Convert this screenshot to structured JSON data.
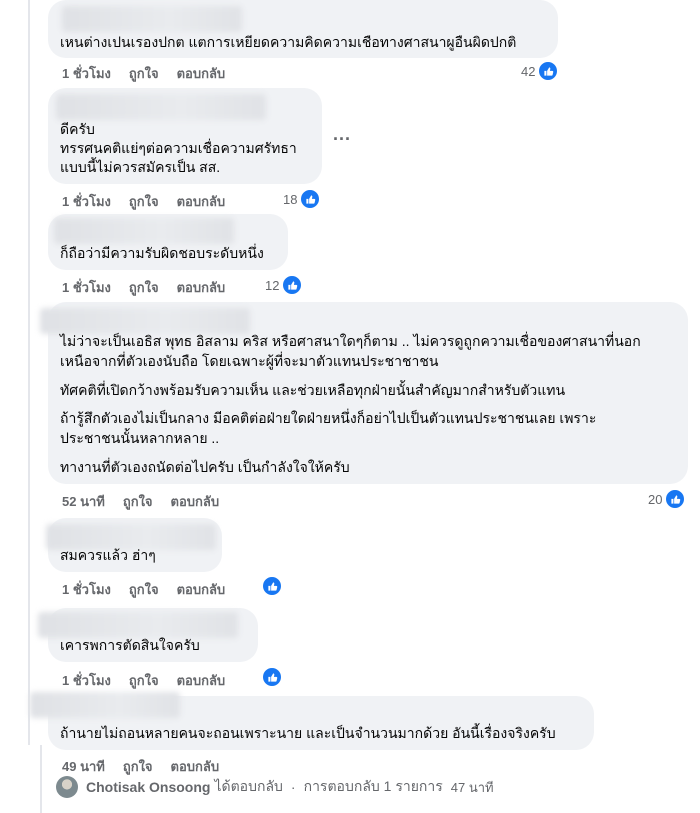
{
  "comments": [
    {
      "lines": [
        "เหนต่างเปนเรองปกต แตการเหยียดความคิดความเชือทางศาสนาผูอืนผิดปกติ"
      ],
      "time": "1 ชั่วโมง",
      "like": "ถูกใจ",
      "reply": "ตอบกลับ",
      "reactions": "42"
    },
    {
      "lines": [
        "ดีครับ",
        "ทรรศนคติแย่ๆต่อความเชื่อความศรัทธา",
        "แบบนี้ไม่ควรสมัครเป็น สส."
      ],
      "time": "1 ชั่วโมง",
      "like": "ถูกใจ",
      "reply": "ตอบกลับ",
      "reactions": "18",
      "more": "..."
    },
    {
      "lines": [
        "ก็ถือว่ามีความรับผิดชอบระดับหนึ่ง"
      ],
      "time": "1 ชั่วโมง",
      "like": "ถูกใจ",
      "reply": "ตอบกลับ",
      "reactions": "12"
    },
    {
      "lines": [
        "ไม่ว่าจะเป็นเอธิส พุทธ อิสลาม คริส หรือศาสนาใดๆก็ตาม .. ไม่ควรดูถูกความเชื่อของศาสนาที่นอก",
        "เหนือจากที่ตัวเองนับถือ โดยเฉพาะผู้ที่จะมาตัวแทนประชาชาชน",
        "ทัศคติที่เปิดกว้างพร้อมรับความเห็น และช่วยเหลือทุกฝ่ายนั้นสำคัญมากสำหรับตัวแทน",
        "ถ้ารู้สึกตัวเองไม่เป็นกลาง มีอคติต่อฝ่ายใดฝ่ายหนึ่งก็อย่าไปเป็นตัวแทนประชาชนเลย เพราะ",
        "ประชาชนนั้นหลากหลาย ..",
        "ทางานที่ตัวเองถนัดต่อไปครับ เป็นกำลังใจให้ครับ"
      ],
      "time": "52 นาที",
      "like": "ถูกใจ",
      "reply": "ตอบกลับ",
      "reactions": "20"
    },
    {
      "lines": [
        "สมควรแล้ว ฮ่าๆ"
      ],
      "time": "1 ชั่วโมง",
      "like": "ถูกใจ",
      "reply": "ตอบกลับ",
      "reactions": ""
    },
    {
      "lines": [
        "เคารพการตัดสินใจครับ"
      ],
      "time": "1 ชั่วโมง",
      "like": "ถูกใจ",
      "reply": "ตอบกลับ",
      "reactions": ""
    },
    {
      "lines": [
        "ถ้านายไม่ถอนหลายคนจะถอนเพราะนาย และเป็นจำนวนมากด้วย อันนี้เรื่องจริงครับ"
      ],
      "time": "49 นาที",
      "like": "ถูกใจ",
      "reply": "ตอบกลับ",
      "reactions": ""
    }
  ],
  "reply_summary": {
    "author": "Chotisak Onsoong",
    "action": "ได้ตอบกลับ",
    "separator": "·",
    "count_text": "การตอบกลับ 1 รายการ",
    "time": "47 นาที"
  },
  "colors": {
    "bubble": "#f0f2f5",
    "like_blue": "#1877f2",
    "meta_gray": "#65676b"
  }
}
